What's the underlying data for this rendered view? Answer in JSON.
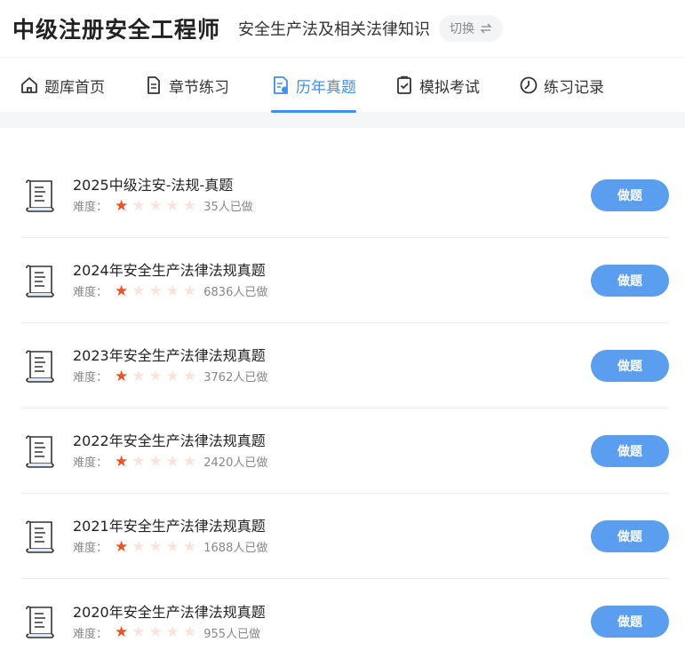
{
  "header": {
    "cert_title": "中级注册安全工程师",
    "subject": "安全生产法及相关法律知识",
    "switch_label": "切换"
  },
  "tabs": [
    {
      "label": "题库首页",
      "icon": "home-icon"
    },
    {
      "label": "章节练习",
      "icon": "document-icon"
    },
    {
      "label": "历年真题",
      "icon": "exam-papers-icon",
      "active": true
    },
    {
      "label": "模拟考试",
      "icon": "checklist-icon"
    },
    {
      "label": "练习记录",
      "icon": "clock-icon"
    }
  ],
  "list": {
    "difficulty_label": "难度：",
    "button_label": "做题",
    "items": [
      {
        "title": "2025中级注安-法规-真题",
        "rating": 1,
        "max_rating": 5,
        "count": "35人已做"
      },
      {
        "title": "2024年安全生产法律法规真题",
        "rating": 1,
        "max_rating": 5,
        "count": "6836人已做"
      },
      {
        "title": "2023年安全生产法律法规真题",
        "rating": 1,
        "max_rating": 5,
        "count": "3762人已做"
      },
      {
        "title": "2022年安全生产法律法规真题",
        "rating": 1,
        "max_rating": 5,
        "count": "2420人已做"
      },
      {
        "title": "2021年安全生产法律法规真题",
        "rating": 1,
        "max_rating": 5,
        "count": "1688人已做"
      },
      {
        "title": "2020年安全生产法律法规真题",
        "rating": 1,
        "max_rating": 5,
        "count": "955人已做"
      }
    ]
  },
  "colors": {
    "accent": "#3f8ff0",
    "button": "#5b9ef0",
    "star_on": "#f2501e",
    "star_off": "#fbe3dd"
  }
}
